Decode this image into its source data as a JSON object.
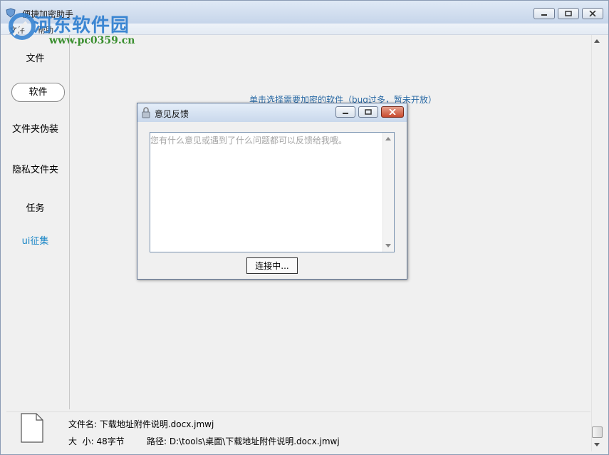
{
  "window": {
    "title": "便捷加密助手",
    "watermark_name": "河东软件园",
    "watermark_url": "www.pc0359.cn"
  },
  "menu": {
    "items": [
      {
        "label": "文件"
      },
      {
        "label": "帮助"
      }
    ]
  },
  "sidebar": {
    "items": [
      {
        "label": "文件"
      },
      {
        "label": "软件"
      },
      {
        "label": "文件夹伪装"
      },
      {
        "label": "隐私文件夹"
      },
      {
        "label": "任务"
      },
      {
        "label": "ui征集"
      }
    ],
    "selected_index": 1
  },
  "content": {
    "hint": "单击选择需要加密的软件（bug过多，暂未开放）"
  },
  "status": {
    "file_name": "文件名: 下载地址附件说明.docx.jmwj",
    "size": "大  小: 48字节",
    "path": "路径: D:\\tools\\桌面\\下载地址附件说明.docx.jmwj"
  },
  "dialog": {
    "title": "意见反馈",
    "placeholder": "您有什么意见或遇到了什么问题都可以反馈给我哦。",
    "value": "",
    "button_label": "连接中..."
  },
  "colors": {
    "accent_link": "#1a86c6",
    "hint_text": "#2a6aa5",
    "watermark_blue": "#2f7fd0",
    "watermark_green": "#3b8f30",
    "close_button": "#c84a2e"
  },
  "icons": {
    "app": "shield-icon",
    "file": "document-icon",
    "dialog": "lock-icon"
  }
}
